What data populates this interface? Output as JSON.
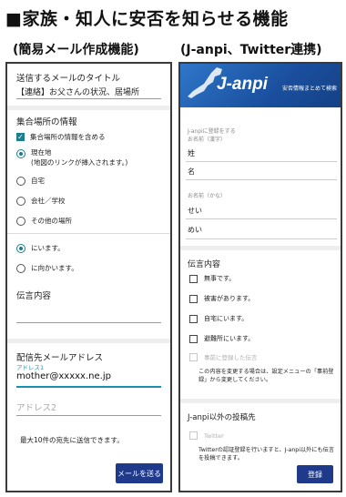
{
  "header": {
    "title": "■家族・知人に安否を知らせる機能",
    "left_caption": "(簡易メール作成機能)",
    "right_caption": "(J-anpi、Twitter連携)"
  },
  "left_screen": {
    "subject_label": "送信するメールのタイトル",
    "subject_value": "【連絡】お父さんの状況、居場所",
    "meeting_section_label": "集合場所の情報",
    "include_meeting_label": "集合場所の情報を含める",
    "location_options": [
      {
        "label": "現在地",
        "sub": "(地図のリンクが挿入されます。)"
      },
      {
        "label": "自宅"
      },
      {
        "label": "会社／学校"
      },
      {
        "label": "その他の場所"
      }
    ],
    "status_options": [
      {
        "label": "にいます。"
      },
      {
        "label": "に向かいます。"
      }
    ],
    "message_label": "伝言内容",
    "recipient_label": "配信先メールアドレス",
    "address1_label": "アドレス1",
    "address1_value": "mother@xxxxx.ne.jp",
    "address2_placeholder": "アドレス2",
    "note": "最大10件の宛先に送信できます。",
    "send_button": "メールを送る"
  },
  "right_screen": {
    "logo": "J-anpi",
    "tagline": "安否情報まとめて検索",
    "name_kanji_label1": "J-anpiに登録をする",
    "name_kanji_label2": "お名前（漢字）",
    "sei": "姓",
    "mei": "名",
    "name_kana_label": "お名前（かな）",
    "sei_kana": "せい",
    "mei_kana": "めい",
    "message_label": "伝言内容",
    "checks": [
      "無事です。",
      "被害があります。",
      "自宅にいます。",
      "避難所にいます。"
    ],
    "disabled_check": "事前に登録した伝言",
    "edit_note": "この内容を変更する場合は、設定メニューの「事前登録」から変更してください。",
    "other_section_label": "J-anpi以外の投稿先",
    "twitter_label": "Twitter",
    "twitter_note": "Twitterの認証登録を行いますと、J-anpi以外にも伝言を投稿できます。",
    "register_button": "登録"
  }
}
